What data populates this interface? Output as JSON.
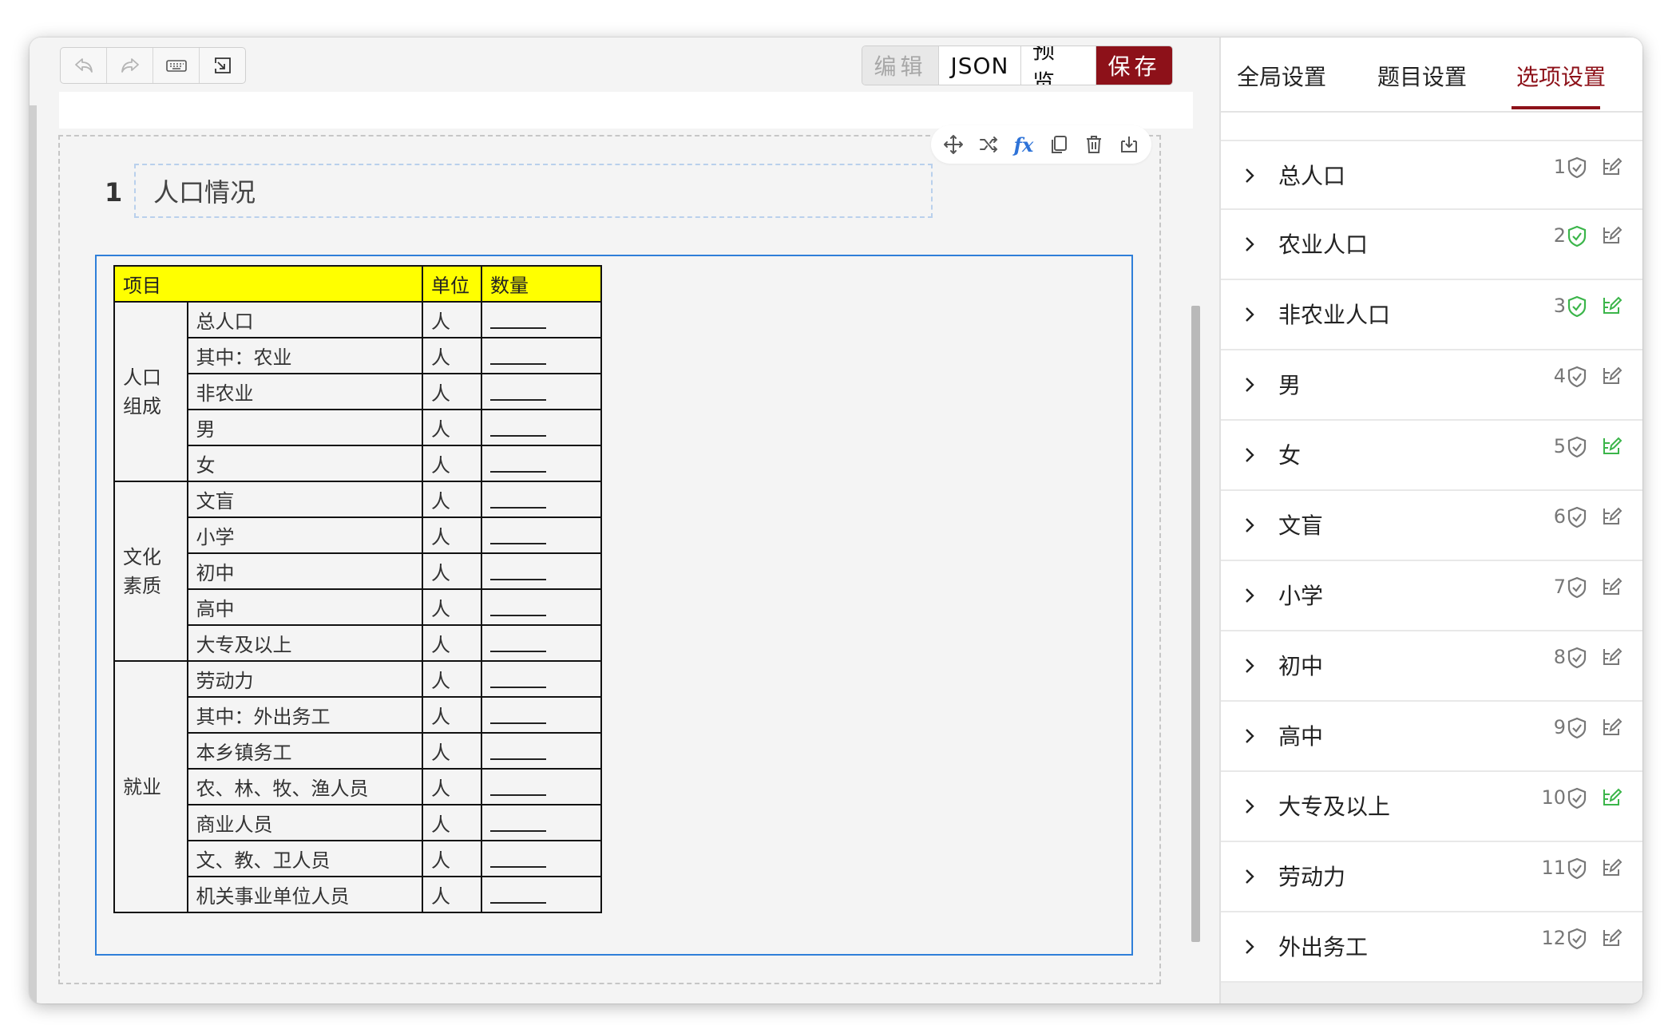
{
  "toolbar": {
    "tools": [
      {
        "icon": "undo-icon",
        "name": "undo-button"
      },
      {
        "icon": "redo-icon",
        "name": "redo-button"
      },
      {
        "icon": "keyboard-icon",
        "name": "keyboard-button"
      },
      {
        "icon": "export-icon",
        "name": "export-button"
      }
    ],
    "modes": {
      "edit": "编辑",
      "json": "JSON",
      "preview": "预览",
      "save": "保存"
    }
  },
  "question": {
    "number": "1",
    "title": "人口情况",
    "actions": [
      "move-icon",
      "shuffle-icon",
      "formula-icon",
      "copy-icon",
      "delete-icon",
      "save-to-bank-icon"
    ],
    "formula_label": "fx"
  },
  "table": {
    "headers": [
      "项目",
      "单位",
      "数量"
    ],
    "groups": [
      {
        "category": "人口组成",
        "rows": [
          "总人口",
          "其中：农业",
          "非农业",
          "男",
          "女"
        ]
      },
      {
        "category": "文化素质",
        "rows": [
          "文盲",
          "小学",
          "初中",
          "高中",
          "大专及以上"
        ]
      },
      {
        "category": "就业",
        "rows": [
          "劳动力",
          "其中：外出务工",
          "本乡镇务工",
          "农、林、牧、渔人员",
          "商业人员",
          "文、教、卫人员",
          "机关事业单位人员"
        ]
      }
    ],
    "unit": "人"
  },
  "panel": {
    "tabs": [
      "全局设置",
      "题目设置",
      "选项设置"
    ],
    "active_tab": "选项设置",
    "options": [
      {
        "label": "总人口",
        "index": "1",
        "shield_green": false,
        "edit_green": false
      },
      {
        "label": "农业人口",
        "index": "2",
        "shield_green": true,
        "edit_green": false
      },
      {
        "label": "非农业人口",
        "index": "3",
        "shield_green": true,
        "edit_green": true
      },
      {
        "label": "男",
        "index": "4",
        "shield_green": false,
        "edit_green": false
      },
      {
        "label": "女",
        "index": "5",
        "shield_green": false,
        "edit_green": true
      },
      {
        "label": "文盲",
        "index": "6",
        "shield_green": false,
        "edit_green": false
      },
      {
        "label": "小学",
        "index": "7",
        "shield_green": false,
        "edit_green": false
      },
      {
        "label": "初中",
        "index": "8",
        "shield_green": false,
        "edit_green": false
      },
      {
        "label": "高中",
        "index": "9",
        "shield_green": false,
        "edit_green": false
      },
      {
        "label": "大专及以上",
        "index": "10",
        "shield_green": false,
        "edit_green": true
      },
      {
        "label": "劳动力",
        "index": "11",
        "shield_green": false,
        "edit_green": false
      },
      {
        "label": "外出务工",
        "index": "12",
        "shield_green": false,
        "edit_green": false
      }
    ]
  },
  "colors": {
    "accent": "#8d1119",
    "header_fill": "#ffff00",
    "selection_border": "#2f7fd9",
    "icon_green": "#3bb54a",
    "icon_gray": "#777777"
  }
}
